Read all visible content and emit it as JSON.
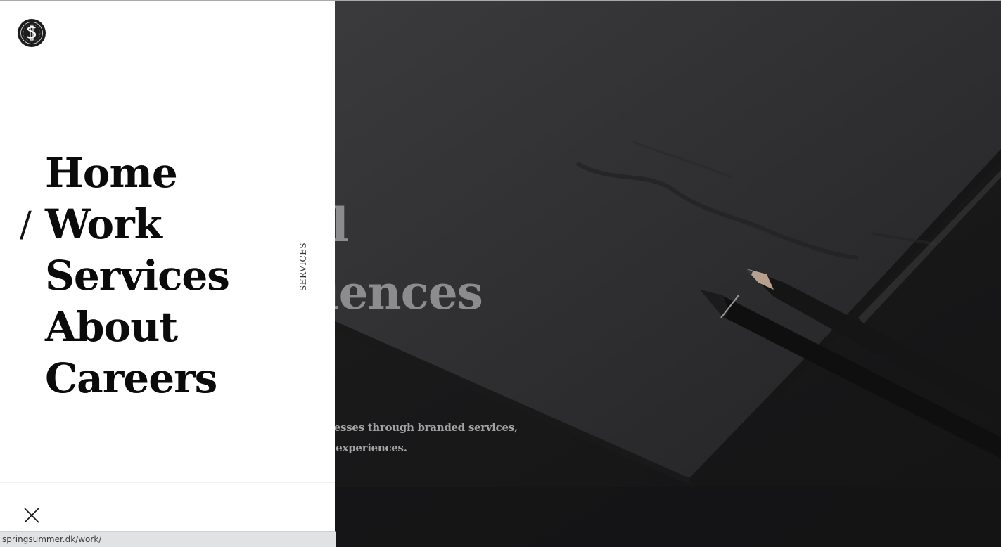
{
  "hero": {
    "heading_line1": "Digital",
    "heading_line2": "Experiences",
    "text_line1": "We help businesses through branded services,",
    "text_line2": "rich shopping experiences."
  },
  "menu": {
    "logo_icon": "springsummer-logo-icon",
    "active_marker": "/",
    "items": [
      {
        "label": "Home",
        "active": false
      },
      {
        "label": "Work",
        "active": true
      },
      {
        "label": "Services",
        "active": false
      },
      {
        "label": "About",
        "active": false
      },
      {
        "label": "Careers",
        "active": false
      }
    ],
    "vertical_label": "SERVICES",
    "close_icon": "close-icon"
  },
  "status_bar": {
    "url": "springsummer.dk/work/"
  },
  "colors": {
    "panel_bg": "#ffffff",
    "menu_text": "#0b0b0b",
    "hero_bg": "#2a2a2c",
    "hero_text": "#8c8c8e"
  }
}
